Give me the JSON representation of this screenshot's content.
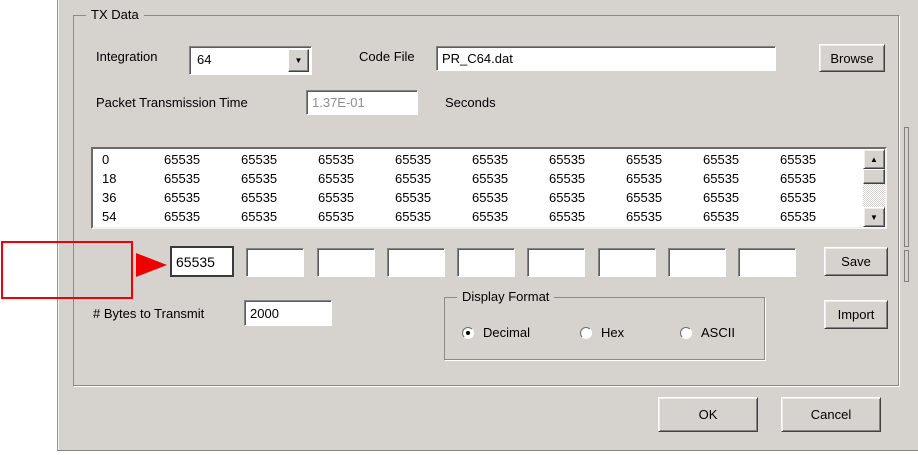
{
  "colors": {
    "dialog_face": "#d6d3ce",
    "annotation_red": "#ee0000",
    "disabled_text": "#8f8f8f"
  },
  "icons": {
    "dropdown_arrow": "▼",
    "scroll_up_arrow": "▲",
    "scroll_down_arrow": "▼"
  },
  "tx_group": {
    "title": "TX Data",
    "integration": {
      "label": "Integration",
      "value": "64"
    },
    "code_file": {
      "label": "Code File",
      "value": "PR_C64.dat"
    },
    "browse_button": "Browse",
    "packet_transmission_time": {
      "label": "Packet Transmission Time",
      "value": "1.37E-01",
      "unit": "Seconds"
    },
    "data_list": {
      "rows": [
        {
          "offset": "0",
          "values": [
            "65535",
            "65535",
            "65535",
            "65535",
            "65535",
            "65535",
            "65535",
            "65535",
            "65535"
          ]
        },
        {
          "offset": "18",
          "values": [
            "65535",
            "65535",
            "65535",
            "65535",
            "65535",
            "65535",
            "65535",
            "65535",
            "65535"
          ]
        },
        {
          "offset": "36",
          "values": [
            "65535",
            "65535",
            "65535",
            "65535",
            "65535",
            "65535",
            "65535",
            "65535",
            "65535"
          ]
        },
        {
          "offset": "54",
          "values": [
            "65535",
            "65535",
            "65535",
            "65535",
            "65535",
            "65535",
            "65535",
            "65535",
            "65535"
          ]
        }
      ]
    },
    "edit_row": {
      "values": [
        "65535",
        "",
        "",
        "",
        "",
        "",
        "",
        "",
        ""
      ]
    },
    "save_button": "Save",
    "bytes_to_transmit": {
      "label": "# Bytes to Transmit",
      "value": "2000"
    },
    "display_format": {
      "title": "Display Format",
      "options": [
        {
          "label": "Decimal",
          "selected": true
        },
        {
          "label": "Hex",
          "selected": false
        },
        {
          "label": "ASCII",
          "selected": false
        }
      ]
    },
    "import_button": "Import"
  },
  "dialog_buttons": {
    "ok": "OK",
    "cancel": "Cancel"
  }
}
